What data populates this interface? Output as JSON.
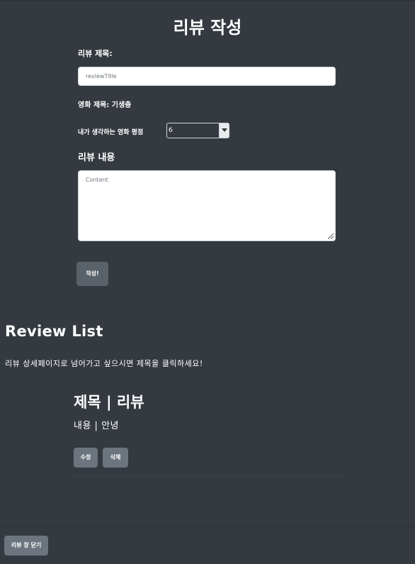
{
  "form": {
    "heading": "리뷰 작성",
    "review_title_label": "리뷰 제목:",
    "review_title_placeholder": "reviewTitle",
    "movie_title_label": "영화 제목: 기생충",
    "rating_label": "내가 생각하는 영화 평점",
    "rating_value": "6",
    "review_content_label": "리뷰 내용",
    "content_placeholder": "Content",
    "submit_label": "작성!"
  },
  "review_list": {
    "heading": "Review List",
    "instruction": "리뷰 상세페이지로 넘어가고 싶으시면 제목을 클릭하세요!",
    "items": [
      {
        "title": "제목 | 리뷰",
        "content": "내용 | 안녕",
        "edit_label": "수정",
        "delete_label": "삭제"
      }
    ]
  },
  "footer": {
    "close_label": "리뷰 창 닫기"
  }
}
